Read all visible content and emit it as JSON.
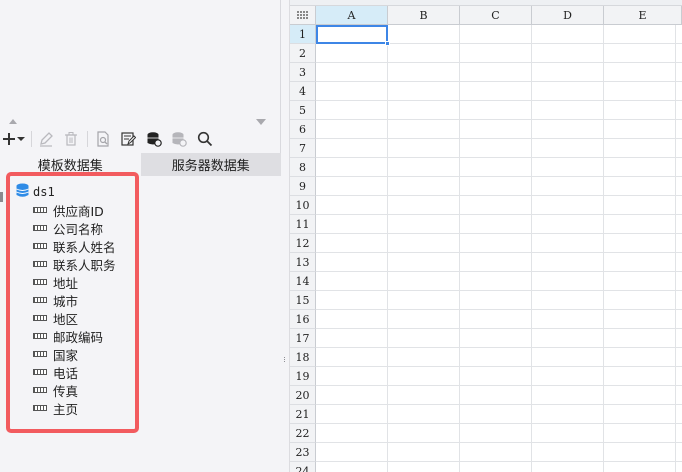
{
  "toolbar": {
    "items": [
      {
        "name": "add-icon",
        "glyph": "+"
      },
      {
        "name": "dropdown-arrow-icon",
        "glyph": "▾"
      },
      {
        "name": "edit-icon",
        "glyph": "pencil"
      },
      {
        "name": "delete-icon",
        "glyph": "trash"
      },
      {
        "name": "preview-icon",
        "glyph": "doc-search"
      },
      {
        "name": "edit-dataset-icon",
        "glyph": "doc-edit"
      },
      {
        "name": "server-dataset-icon",
        "glyph": "db"
      },
      {
        "name": "server-dataset-gray-icon",
        "glyph": "db"
      },
      {
        "name": "search-icon",
        "glyph": "magnifier"
      }
    ]
  },
  "tabs": [
    {
      "label": "模板数据集",
      "active": true
    },
    {
      "label": "服务器数据集",
      "active": false
    }
  ],
  "tree": {
    "dataset": "ds1",
    "fields": [
      "供应商ID",
      "公司名称",
      "联系人姓名",
      "联系人职务",
      "地址",
      "城市",
      "地区",
      "邮政编码",
      "国家",
      "电话",
      "传真",
      "主页"
    ]
  },
  "sheet": {
    "columns": [
      "A",
      "B",
      "C",
      "D",
      "E"
    ],
    "rows": [
      "1",
      "2",
      "3",
      "4",
      "5",
      "6",
      "7",
      "8",
      "9",
      "10",
      "11",
      "12",
      "13",
      "14",
      "15",
      "16",
      "17",
      "18",
      "19",
      "20",
      "21",
      "22",
      "23",
      "24"
    ],
    "selected_cell": "A1"
  },
  "colors": {
    "highlight_border": "#f25b5f",
    "selection": "#3d86e6",
    "header_selected": "#d6ecf8"
  }
}
